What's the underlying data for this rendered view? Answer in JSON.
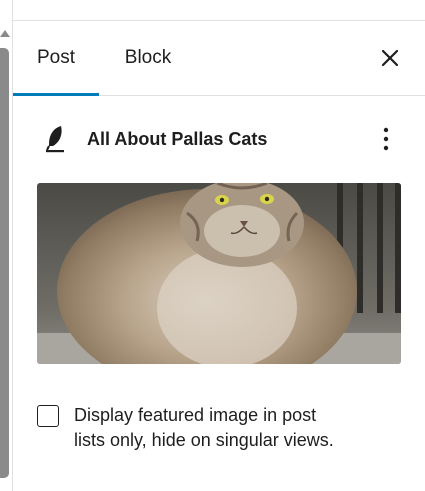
{
  "sidebar": {
    "tabs": [
      {
        "label": "Post",
        "active": true
      },
      {
        "label": "Block",
        "active": false
      }
    ],
    "close_icon": "close-icon",
    "accent_color": "#007cba"
  },
  "post_summary": {
    "icon": "feather-icon",
    "title": "All About Pallas Cats",
    "more_icon": "more-vertical-icon"
  },
  "featured_image": {
    "subject": "pallas-cat-photo"
  },
  "featured_image_option": {
    "checked": false,
    "label": "Display featured image in post lists only, hide on singular views."
  }
}
